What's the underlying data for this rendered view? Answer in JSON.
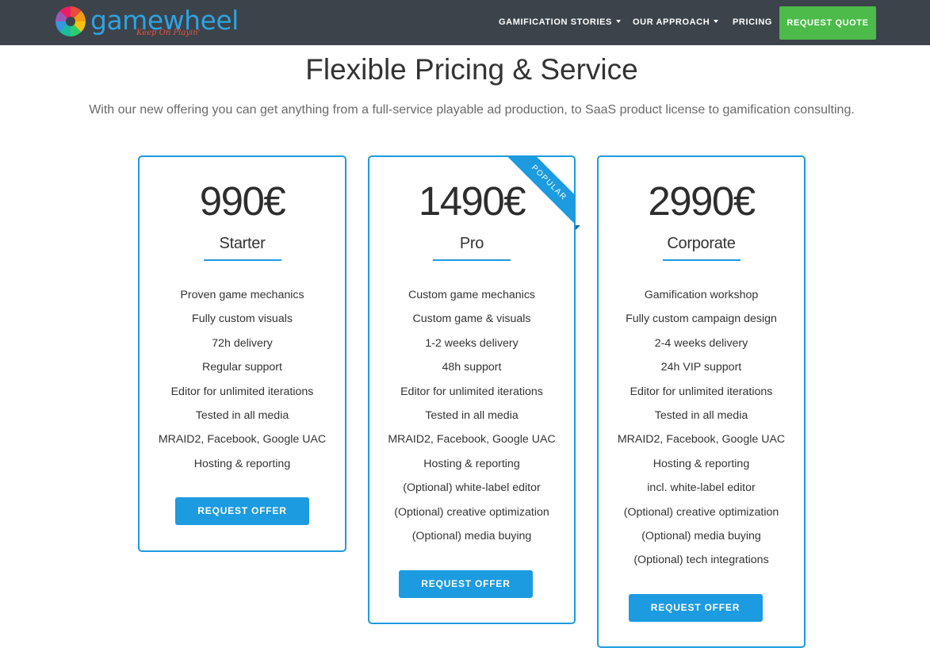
{
  "nav": {
    "logo_text": "gamewheel",
    "logo_tagline": "Keep On Playin'",
    "items": [
      {
        "label": "GAMIFICATION STORIES",
        "dropdown": true
      },
      {
        "label": "OUR APPROACH",
        "dropdown": true
      },
      {
        "label": "PRICING",
        "dropdown": false
      }
    ],
    "cta_label": "REQUEST QUOTE"
  },
  "header": {
    "title": "Flexible Pricing & Service",
    "subtitle": "With our new offering you can get anything from a full-service playable ad production, to SaaS product license to gamification consulting."
  },
  "plans": [
    {
      "price": "990€",
      "name": "Starter",
      "features": [
        "Proven game mechanics",
        "Fully custom visuals",
        "72h delivery",
        "Regular support",
        "Editor for unlimited iterations",
        "Tested in all media",
        "MRAID2, Facebook, Google UAC",
        "Hosting & reporting"
      ],
      "button": "REQUEST OFFER"
    },
    {
      "price": "1490€",
      "name": "Pro",
      "ribbon": "POPULAR",
      "features": [
        "Custom game mechanics",
        "Custom game & visuals",
        "1-2 weeks delivery",
        "48h support",
        "Editor for unlimited iterations",
        "Tested in all media",
        "MRAID2, Facebook, Google UAC",
        "Hosting & reporting",
        "(Optional) white-label editor",
        "(Optional) creative optimization",
        "(Optional) media buying"
      ],
      "button": "REQUEST OFFER"
    },
    {
      "price": "2990€",
      "name": "Corporate",
      "features": [
        "Gamification workshop",
        "Fully custom campaign design",
        "2-4 weeks delivery",
        "24h VIP support",
        "Editor for unlimited iterations",
        "Tested in all media",
        "MRAID2, Facebook, Google UAC",
        "Hosting & reporting",
        "incl. white-label editor",
        "(Optional) creative optimization",
        "(Optional) media buying",
        "(Optional) tech integrations"
      ],
      "button": "REQUEST OFFER"
    }
  ],
  "colors": {
    "nav_bg": "#3c434b",
    "accent": "#1c9be0",
    "cta_green": "#4cbb4a"
  }
}
